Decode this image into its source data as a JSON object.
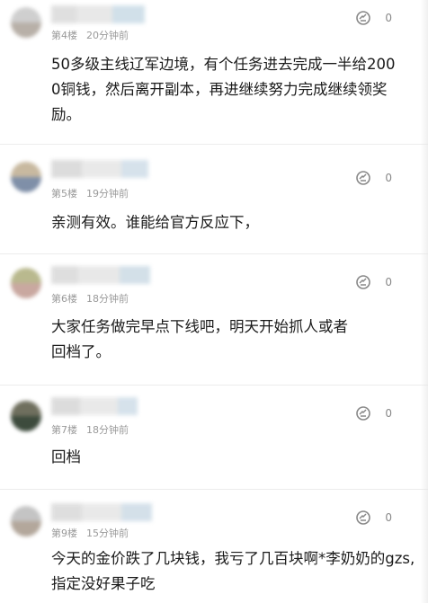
{
  "comments": [
    {
      "floor": "第4楼",
      "time": "20分钟前",
      "likes": "0",
      "text": "50多级主线辽军边境，有个任务进去完成一半给2000铜钱，然后离开副本，再进继续努力完成继续领奖励。",
      "avatar_colors": [
        "#cfcfcf",
        "#b8b0a8"
      ]
    },
    {
      "floor": "第5楼",
      "time": "19分钟前",
      "likes": "0",
      "text": "亲测有效。谁能给官方反应下，",
      "avatar_colors": [
        "#c8b9a0",
        "#7f8fa8"
      ]
    },
    {
      "floor": "第6楼",
      "time": "18分钟前",
      "likes": "0",
      "text": "大家任务做完早点下线吧，明天开始抓人或者回档了。",
      "avatar_colors": [
        "#b9b98e",
        "#c9a8a0"
      ]
    },
    {
      "floor": "第7楼",
      "time": "18分钟前",
      "likes": "0",
      "text": "回档",
      "avatar_colors": [
        "#6f6f5e",
        "#3d4b3d"
      ]
    },
    {
      "floor": "第9楼",
      "time": "15分钟前",
      "likes": "0",
      "text": "今天的金价跌了几块钱，我亏了几百块啊*李奶奶的gzs,指定没好果子吃",
      "avatar_colors": [
        "#c4c4c4",
        "#b3a79b"
      ]
    }
  ],
  "colors": {
    "name_blur": [
      "#d8d8d8",
      "#e3e3e3",
      "#c9dbe6"
    ]
  }
}
